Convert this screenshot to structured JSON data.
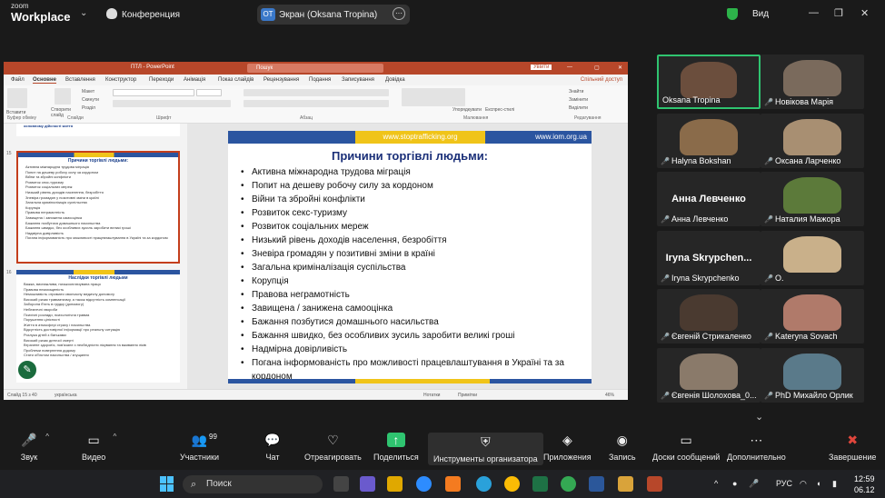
{
  "app": {
    "brand_line1": "zoom",
    "brand_line2": "Workplace",
    "conference": "Конференция",
    "screen_initials": "OT",
    "screen_label": "Экран (Oksana Tropina)",
    "view_label": "Вид"
  },
  "ppt": {
    "title": "ПТЛ  -  PowerPoint",
    "search": "Пошук",
    "signin": "Увійти",
    "tabs": [
      "Файл",
      "Основне",
      "Вставлення",
      "Конструктор",
      "Переходи",
      "Анімація",
      "Показ слайдів",
      "Рецензування",
      "Подання",
      "Записування",
      "Довідка"
    ],
    "share": "Спільний доступ",
    "ribbon_groups": [
      "Буфер обміну",
      "Слайди",
      "Шрифт",
      "Абзац",
      "Малювання",
      "Редагування"
    ],
    "ribbon_labels": [
      "Вставити",
      "Створити слайд",
      "Макет",
      "Скинути",
      "Розділ",
      "Упорядкувати",
      "Експрес-стилі",
      "Знайти",
      "Замінити",
      "Виділити"
    ],
    "status_left": "Слайд 15 з 40",
    "status_lang": "українська",
    "status_notes": "Нотатки",
    "status_comments": "Примітки",
    "status_zoom": "46%",
    "thumb_prev_text": "основному дійсності життя",
    "thumb15_num": "15",
    "thumb15_title": "Причини торгівлі людьми:",
    "thumb15_lines": [
      "Активна міжнародна трудова міграція",
      "Попит на дешеву робочу силу за кордоном",
      "Війни та збройні конфлікти",
      "Розвиток секс-туризму",
      "Розвиток соціальних мереж",
      "Низький рівень доходів населення, безробіття",
      "Зневіра громадян у позитивні зміни в країні",
      "Загальна криміналізація суспільства",
      "Корупція",
      "Правова неграмотність",
      "Завищена / занижена самооцінка",
      "Бажання позбутися домашнього насильства",
      "Бажання швидко, без особливих зусиль заробити великі гроші",
      "Надмірна довірливість",
      "Погана інформованість про можливості працевлаштування в Україні та за кордоном"
    ],
    "thumb16_num": "16",
    "thumb16_title": "Наслідки торгівлі людьми",
    "thumb16_lines": [
      "Важка, виснажлива, низькооплачувана праця",
      "Правова незахищеність",
      "Неможливість отримати своєчасну медичну допомогу",
      "Високий ризик травматизму, а також відсутність компенсації",
      "Заборона б'ють в грудку (допомогу)",
      "Небезпечні хвороби",
      "Психічні розлади, психологічна травма",
      "Порушення цілісності",
      "Життя в атмосфері страху і насильства",
      "Відсутність достовірної інформації про реальну ситуацію",
      "Розлука дітей з батьками",
      "Високий ризик дитячої смерті",
      "Втрачене здоров'я, пов'язане з необхідністю лікування та вживання ліків",
      "Проблеми повернення додому",
      "Стати об'єктом насильства / знущання"
    ],
    "slide": {
      "banner_center": "www.stoptrafficking.org",
      "banner_right": "www.iom.org.ua",
      "title": "Причини торгівлі людьми:",
      "bullets": [
        "Активна міжнародна трудова міграція",
        "Попит на дешеву робочу силу за кордоном",
        "Війни та збройні конфлікти",
        "Розвиток секс-туризму",
        "Розвиток соціальних мереж",
        "Низький рівень доходів населення, безробіття",
        "Зневіра громадян у позитивні зміни в країні",
        "Загальна криміналізація суспільства",
        "Корупція",
        "Правова неграмотність",
        "Завищена / занижена самооцінка",
        "Бажання позбутися домашнього насильства",
        "Бажання швидко, без особливих зусиль заробити великі гроші",
        "Надмірна довірливість",
        "Погана інформованість про можливості працевлаштування в Україні та за кордоном"
      ]
    }
  },
  "participants": [
    {
      "name": "Oksana Tropina",
      "muted": false,
      "video": true,
      "speaking": true
    },
    {
      "name": "Новікова Марія",
      "muted": true,
      "video": true
    },
    {
      "name": "Halyna Bokshan",
      "muted": true,
      "video": true
    },
    {
      "name": "Оксана Ларченко",
      "muted": true,
      "video": true
    },
    {
      "name": "Анна Левченко",
      "muted": true,
      "video": false,
      "display": "Анна Левченко"
    },
    {
      "name": "Наталия Мажора",
      "muted": true,
      "video": true
    },
    {
      "name": "Iryna Skrypchenko",
      "muted": true,
      "video": false,
      "display": "Iryna Skrypchen..."
    },
    {
      "name": "O.",
      "muted": true,
      "video": true
    },
    {
      "name": "Євгеній Стрикаленко",
      "muted": true,
      "video": true
    },
    {
      "name": "Kateryna Sovach",
      "muted": true,
      "video": true
    },
    {
      "name": "Євгенія Шолохова_0...",
      "muted": true,
      "video": true
    },
    {
      "name": "PhD Михайло Орлик",
      "muted": true,
      "video": true
    }
  ],
  "toolbar": {
    "audio": "Звук",
    "video": "Видео",
    "participants": "Участники",
    "participants_count": "99",
    "chat": "Чат",
    "react": "Отреагировать",
    "share": "Поделиться",
    "host_tools": "Инструменты организатора",
    "apps": "Приложения",
    "record": "Запись",
    "whiteboards": "Доски сообщений",
    "more": "Дополнительно",
    "end": "Завершение"
  },
  "taskbar": {
    "search": "Поиск",
    "lang": "РУС",
    "time": "12:59",
    "date": "06.12"
  },
  "colors": {
    "speaking": "#2fc470",
    "ppt": "#b7472a",
    "share": "#2fc470",
    "end": "#e0463c"
  }
}
